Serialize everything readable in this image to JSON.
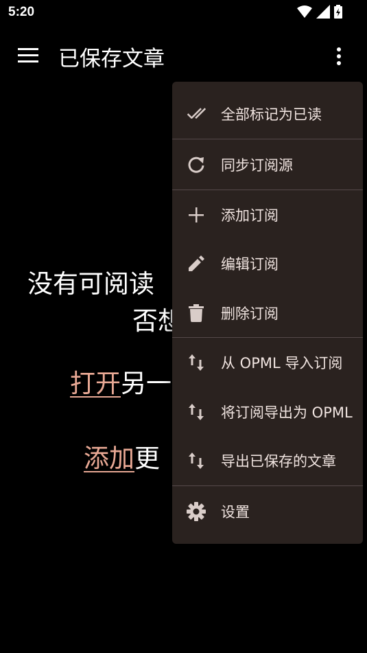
{
  "status": {
    "time": "5:20"
  },
  "app_bar": {
    "title": "已保存文章"
  },
  "empty": {
    "line1": "没有可阅读",
    "line2": "否想",
    "open_link": "打开",
    "open_rest": "另一",
    "add_link": "添加",
    "add_rest": "更"
  },
  "menu": {
    "items": [
      {
        "label": "全部标记为已读",
        "icon": "double-check-icon"
      },
      {
        "label": "同步订阅源",
        "icon": "refresh-icon"
      },
      {
        "label": "添加订阅",
        "icon": "plus-icon"
      },
      {
        "label": "编辑订阅",
        "icon": "pencil-icon"
      },
      {
        "label": "删除订阅",
        "icon": "trash-icon"
      },
      {
        "label": "从 OPML 导入订阅",
        "icon": "import-export-icon"
      },
      {
        "label": "将订阅导出为 OPML",
        "icon": "import-export-icon"
      },
      {
        "label": "导出已保存的文章",
        "icon": "import-export-icon"
      },
      {
        "label": "设置",
        "icon": "gear-icon"
      }
    ]
  },
  "colors": {
    "background": "#000000",
    "menu_bg": "#2a221f",
    "link": "#e8a894"
  }
}
